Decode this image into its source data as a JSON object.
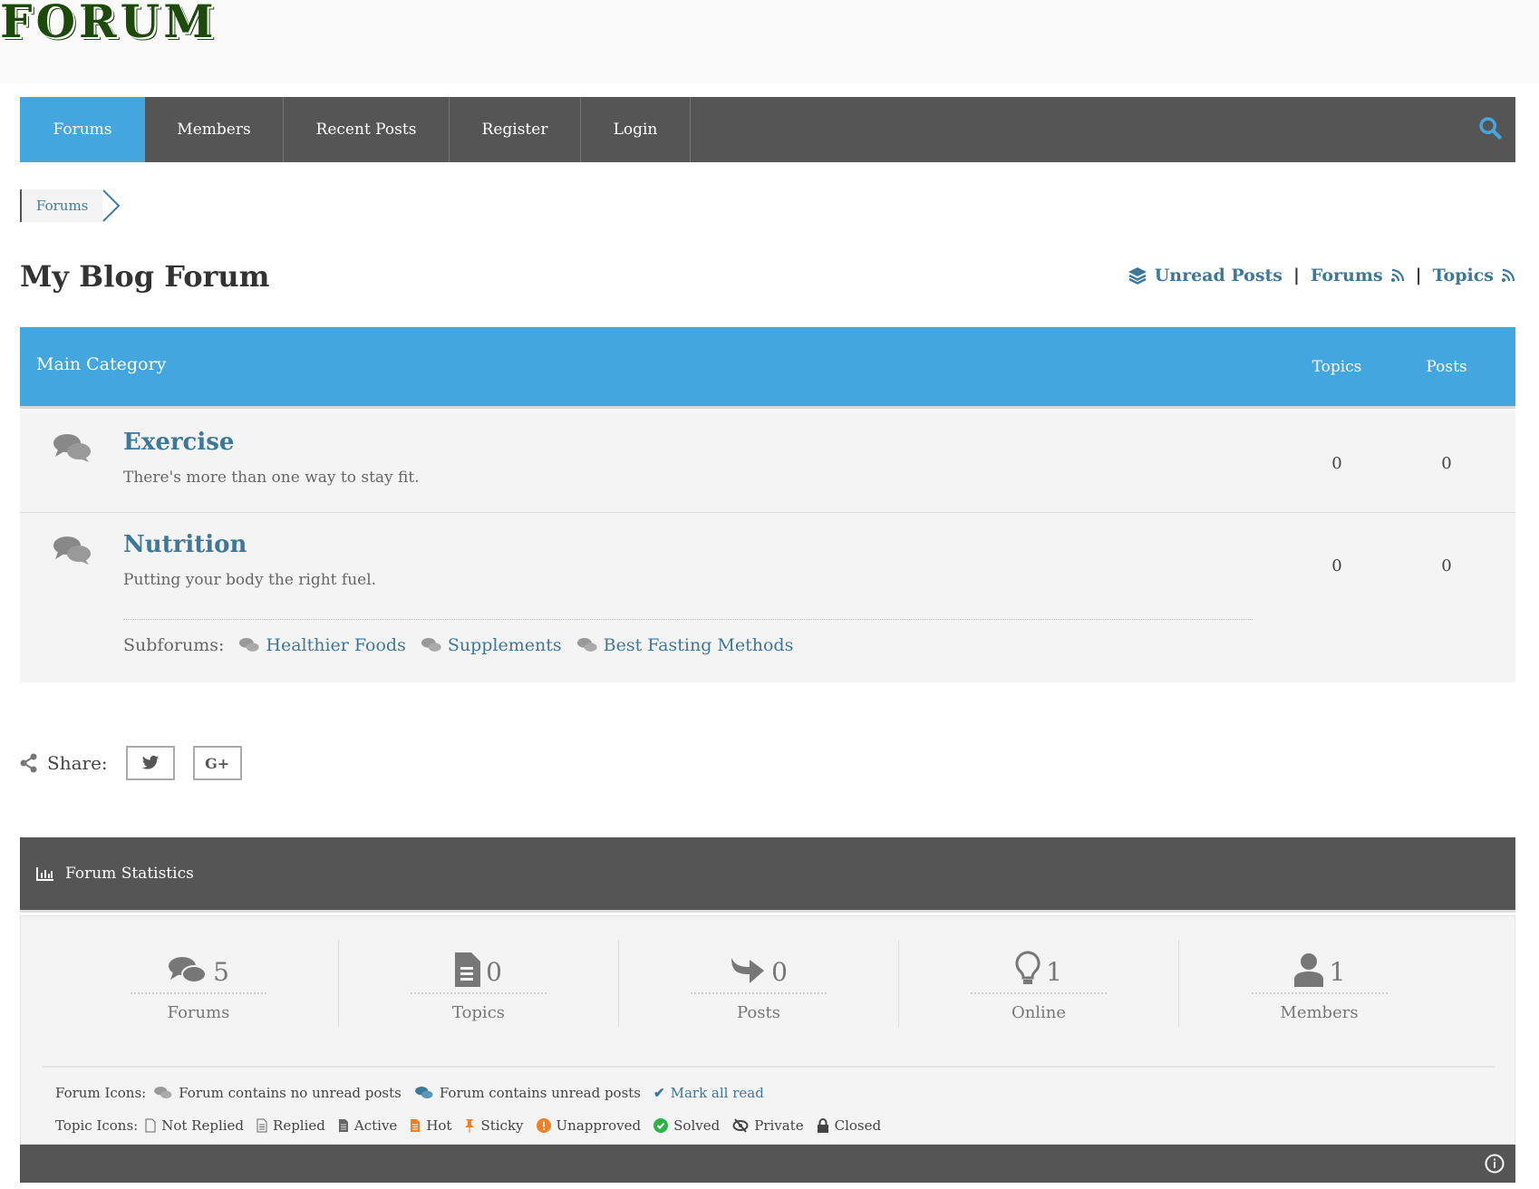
{
  "logo": "FORUM",
  "nav": {
    "items": [
      "Forums",
      "Members",
      "Recent Posts",
      "Register",
      "Login"
    ]
  },
  "breadcrumb": [
    "Forums"
  ],
  "page_title": "My Blog Forum",
  "quick_links": {
    "unread": "Unread Posts",
    "forums": "Forums",
    "topics": "Topics",
    "sep": "|"
  },
  "category": {
    "name": "Main Category",
    "col_topics": "Topics",
    "col_posts": "Posts"
  },
  "forums": [
    {
      "name": "Exercise",
      "desc": "There's more than one way to stay fit.",
      "topics": "0",
      "posts": "0"
    },
    {
      "name": "Nutrition",
      "desc": "Putting your body the right fuel.",
      "topics": "0",
      "posts": "0",
      "subforums_label": "Subforums:",
      "subforums": [
        "Healthier Foods",
        "Supplements",
        "Best Fasting Methods"
      ]
    }
  ],
  "share": {
    "label": "Share:"
  },
  "stats": {
    "title": "Forum Statistics",
    "items": [
      {
        "value": "5",
        "label": "Forums"
      },
      {
        "value": "0",
        "label": "Topics"
      },
      {
        "value": "0",
        "label": "Posts"
      },
      {
        "value": "1",
        "label": "Online"
      },
      {
        "value": "1",
        "label": "Members"
      }
    ]
  },
  "legend": {
    "forum_label": "Forum Icons:",
    "no_unread": "Forum contains no unread posts",
    "unread": "Forum contains unread posts",
    "mark_read": "Mark all read",
    "topic_label": "Topic Icons:",
    "topic_icons": [
      "Not Replied",
      "Replied",
      "Active",
      "Hot",
      "Sticky",
      "Unapproved",
      "Solved",
      "Private",
      "Closed"
    ]
  },
  "colors": {
    "accent": "#44a6df",
    "nav": "#555555",
    "link": "#3e7898",
    "logo": "#1d4a0b"
  }
}
